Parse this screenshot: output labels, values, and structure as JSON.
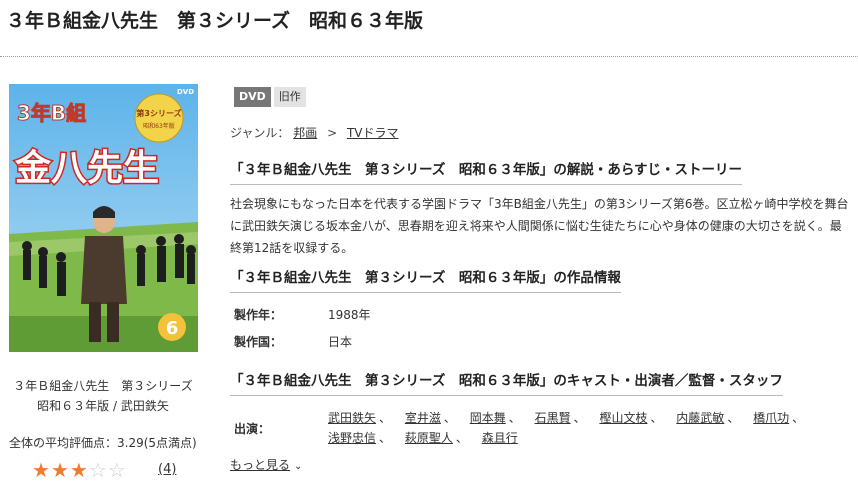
{
  "page": {
    "title": "３年Ｂ組金八先生　第３シリーズ　昭和６３年版"
  },
  "product": {
    "cover_alt": "３年Ｂ組金八先生 第３シリーズ 昭和６３年版",
    "cover_logo_line1": "3年B組",
    "cover_logo_line2": "金八先生",
    "cover_series": "第3シリーズ",
    "cover_edition": "昭和63年版",
    "cover_dvd_mark": "DVD",
    "cover_volume": "6",
    "left_title_line1": "３年Ｂ組金八先生　第３シリーズ",
    "left_title_line2": "昭和６３年版 / 武田鉄矢",
    "rating_text": "全体の平均評価点：3.29(5点満点)",
    "rating_value": 3,
    "rating_max": 5,
    "review_count": "(4)"
  },
  "badges": {
    "format": "DVD",
    "status": "旧作"
  },
  "genre": {
    "label": "ジャンル：",
    "items": [
      "邦画",
      "TVドラマ"
    ],
    "separator": ">"
  },
  "sections": {
    "synopsis_heading": "「３年Ｂ組金八先生　第３シリーズ　昭和６３年版」の解説・あらすじ・ストーリー",
    "synopsis_text": "社会現象にもなった日本を代表する学園ドラマ「3年B組金八先生」の第3シリーズ第6巻。区立松ヶ崎中学校を舞台に武田鉄矢演じる坂本金八が、思春期を迎え将来や人間関係に悩む生徒たちに心や身体の健康の大切さを説く。最終第12話を収録する。",
    "info_heading": "「３年Ｂ組金八先生　第３シリーズ　昭和６３年版」の作品情報",
    "cast_heading": "「３年Ｂ組金八先生　第３シリーズ　昭和６３年版」のキャスト・出演者／監督・スタッフ"
  },
  "info": {
    "year_label": "製作年：",
    "year_value": "1988年",
    "country_label": "製作国：",
    "country_value": "日本"
  },
  "cast": {
    "label": "出演：",
    "members": [
      "武田鉄矢",
      "室井滋",
      "岡本舞",
      "石黒賢",
      "樫山文枝",
      "内藤武敏",
      "橋爪功",
      "浅野忠信",
      "萩原聖人",
      "森且行"
    ],
    "more_label": "もっと見る"
  },
  "colors": {
    "star_on": "#ef7d30",
    "star_off": "#cfcfcf",
    "badge_dvd_bg": "#777777",
    "badge_old_bg": "#e3e3e3"
  },
  "icons": {
    "star": "star-icon",
    "more": "chevron-down-icon"
  }
}
